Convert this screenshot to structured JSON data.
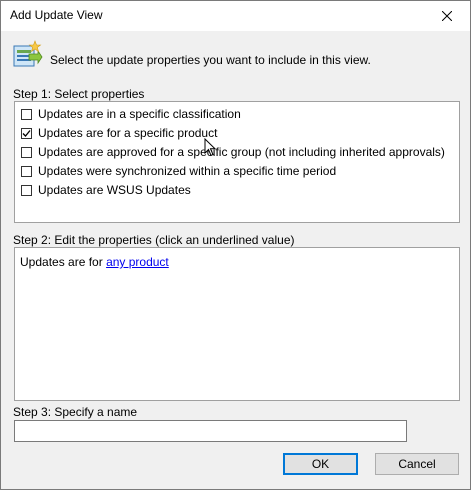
{
  "window": {
    "title": "Add Update View"
  },
  "header": {
    "icon": "add-view-icon",
    "text": "Select the update properties you want to include in this view."
  },
  "step1": {
    "label": "Step 1: Select properties",
    "items": [
      {
        "label": "Updates are in a specific classification",
        "checked": false
      },
      {
        "label": "Updates are for a specific product",
        "checked": true
      },
      {
        "label": "Updates are approved for a specific group (not including inherited approvals)",
        "checked": false
      },
      {
        "label": "Updates were synchronized within a specific time period",
        "checked": false
      },
      {
        "label": "Updates are WSUS Updates",
        "checked": false
      }
    ]
  },
  "step2": {
    "label": "Step 2: Edit the properties (click an underlined value)",
    "prefix": "Updates are for",
    "link": "any product"
  },
  "step3": {
    "label": "Step 3: Specify a name",
    "value": ""
  },
  "buttons": {
    "ok": "OK",
    "cancel": "Cancel"
  }
}
